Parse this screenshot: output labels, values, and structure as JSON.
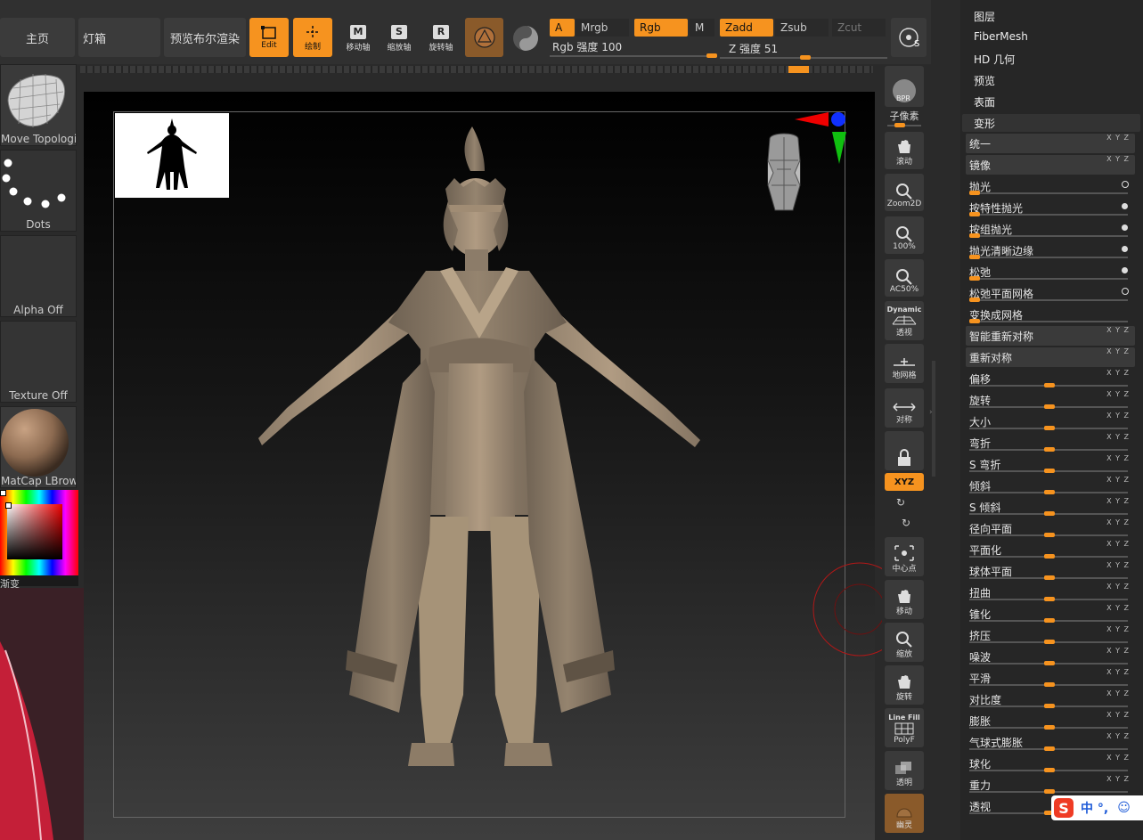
{
  "top_bar": {
    "home": "主页",
    "lightbox": "灯箱",
    "bpr_preview": "预览布尔渲染",
    "edit": "Edit",
    "draw": "绘制",
    "move": "移动轴",
    "scale": "缩放轴",
    "rotate": "旋转轴",
    "a": "A",
    "mrgb": "Mrgb",
    "rgb": "Rgb",
    "m": "M",
    "zadd": "Zadd",
    "zsub": "Zsub",
    "zcut": "Zcut",
    "rgb_intensity": "Rgb 强度 100",
    "z_intensity": "Z 强度 51",
    "rgb_intensity_value": 100,
    "z_intensity_value": 51
  },
  "left_shelf": {
    "brush": "Move Topological",
    "stroke": "Dots",
    "alpha": "Alpha Off",
    "texture": "Texture Off",
    "material": "MatCap LBrown",
    "gradient": "渐变"
  },
  "right_tools": [
    {
      "id": "bpr",
      "label": "BPR"
    },
    {
      "id": "subpixel",
      "label": "子像素"
    },
    {
      "id": "scroll",
      "label": "滚动"
    },
    {
      "id": "zoom2d",
      "label": "Zoom2D"
    },
    {
      "id": "actual",
      "label": "100%"
    },
    {
      "id": "ac50",
      "label": "AC50%"
    },
    {
      "id": "persp",
      "label": "透视"
    },
    {
      "id": "floor",
      "label": "地网格"
    },
    {
      "id": "sym",
      "label": "对称"
    },
    {
      "id": "lock",
      "label": ""
    },
    {
      "id": "xyz",
      "label": "XYZ"
    },
    {
      "id": "center",
      "label": "中心点"
    },
    {
      "id": "move",
      "label": "移动"
    },
    {
      "id": "scale",
      "label": "缩放"
    },
    {
      "id": "rotate",
      "label": "旋转"
    },
    {
      "id": "polyf",
      "label": "PolyF"
    },
    {
      "id": "transp",
      "label": "透明"
    },
    {
      "id": "ghost",
      "label": "幽灵"
    }
  ],
  "right_tools_extra": {
    "dynamic": "Dynamic",
    "linefill": "Line Fill"
  },
  "menu": {
    "layers": "图层",
    "fibermesh": "FiberMesh",
    "hd": "HD 几何",
    "preview": "预览",
    "surface": "表面",
    "deformation": "变形"
  },
  "deformation": [
    {
      "label": "统一",
      "kind": "header"
    },
    {
      "label": "镜像",
      "kind": "header"
    },
    {
      "label": "抛光",
      "kind": "ring"
    },
    {
      "label": "按特性抛光",
      "kind": "dot"
    },
    {
      "label": "按组抛光",
      "kind": "dot"
    },
    {
      "label": "抛光清晰边缘",
      "kind": "dot"
    },
    {
      "label": "松弛",
      "kind": "dot"
    },
    {
      "label": "松弛平面网格",
      "kind": "ring"
    },
    {
      "label": "变换成网格",
      "kind": "plain"
    },
    {
      "label": "智能重新对称",
      "kind": "header"
    },
    {
      "label": "重新对称",
      "kind": "header"
    },
    {
      "label": "偏移",
      "kind": "slider"
    },
    {
      "label": "旋转",
      "kind": "slider"
    },
    {
      "label": "大小",
      "kind": "slider"
    },
    {
      "label": "弯折",
      "kind": "slider"
    },
    {
      "label": "S 弯折",
      "kind": "slider"
    },
    {
      "label": "倾斜",
      "kind": "slider"
    },
    {
      "label": "S 倾斜",
      "kind": "slider"
    },
    {
      "label": "径向平面",
      "kind": "slider"
    },
    {
      "label": "平面化",
      "kind": "slider"
    },
    {
      "label": "球体平面",
      "kind": "slider"
    },
    {
      "label": "扭曲",
      "kind": "slider"
    },
    {
      "label": "锥化",
      "kind": "slider"
    },
    {
      "label": "挤压",
      "kind": "slider"
    },
    {
      "label": "噪波",
      "kind": "slider"
    },
    {
      "label": "平滑",
      "kind": "slider"
    },
    {
      "label": "对比度",
      "kind": "slider"
    },
    {
      "label": "膨胀",
      "kind": "slider"
    },
    {
      "label": "气球式膨胀",
      "kind": "slider"
    },
    {
      "label": "球化",
      "kind": "slider"
    },
    {
      "label": "重力",
      "kind": "slider"
    },
    {
      "label": "透视",
      "kind": "slider"
    }
  ],
  "xyz_label": "X Y Z",
  "ime": {
    "text": "中 °,",
    "logo": "S"
  },
  "colors": {
    "accent": "#f6931f",
    "panel": "#3a3a3a",
    "clay": "#8a7a66"
  }
}
